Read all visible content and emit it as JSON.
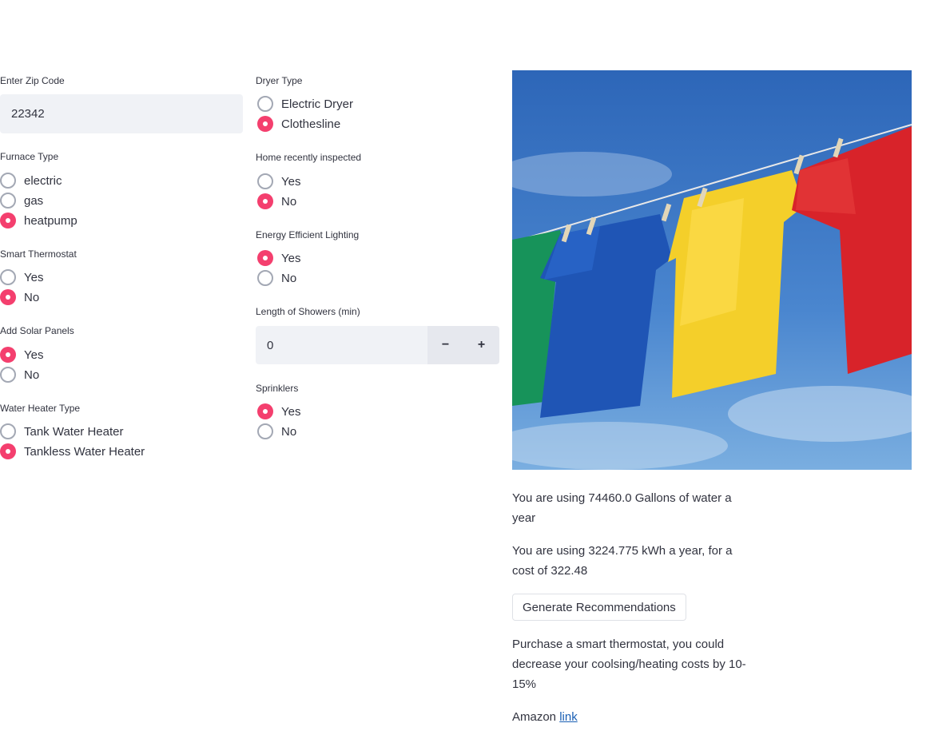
{
  "colors": {
    "accent": "#f43f6e",
    "input_bg": "#f0f2f6",
    "text": "#31333f",
    "link": "#1a5fb4"
  },
  "zip": {
    "label": "Enter Zip Code",
    "value": "22342"
  },
  "furnace": {
    "label": "Furnace Type",
    "options": [
      "electric",
      "gas",
      "heatpump"
    ],
    "selected": "heatpump"
  },
  "thermostat": {
    "label": "Smart Thermostat",
    "options": [
      "Yes",
      "No"
    ],
    "selected": "No"
  },
  "solar": {
    "label": "Add Solar Panels",
    "options": [
      "Yes",
      "No"
    ],
    "selected": "Yes"
  },
  "water_heater": {
    "label": "Water Heater Type",
    "options": [
      "Tank Water Heater",
      "Tankless Water Heater"
    ],
    "selected": "Tankless Water Heater"
  },
  "dryer": {
    "label": "Dryer Type",
    "options": [
      "Electric Dryer",
      "Clothesline"
    ],
    "selected": "Clothesline"
  },
  "inspected": {
    "label": "Home recently inspected",
    "options": [
      "Yes",
      "No"
    ],
    "selected": "No"
  },
  "lighting": {
    "label": "Energy Efficient Lighting",
    "options": [
      "Yes",
      "No"
    ],
    "selected": "Yes"
  },
  "showers": {
    "label": "Length of Showers (min)",
    "value": "0",
    "minus": "−",
    "plus": "+"
  },
  "sprinklers": {
    "label": "Sprinklers",
    "options": [
      "Yes",
      "No"
    ],
    "selected": "Yes"
  },
  "results": {
    "water": "You are using 74460.0 Gallons of water a year",
    "energy": "You are using 3224.775 kWh a year, for a cost of 322.48",
    "button": "Generate Recommendations",
    "recommendation": "Purchase a smart thermostat, you could decrease your coolsing/heating costs by 10-15%",
    "amazon_prefix": "Amazon ",
    "amazon_link": "link"
  }
}
